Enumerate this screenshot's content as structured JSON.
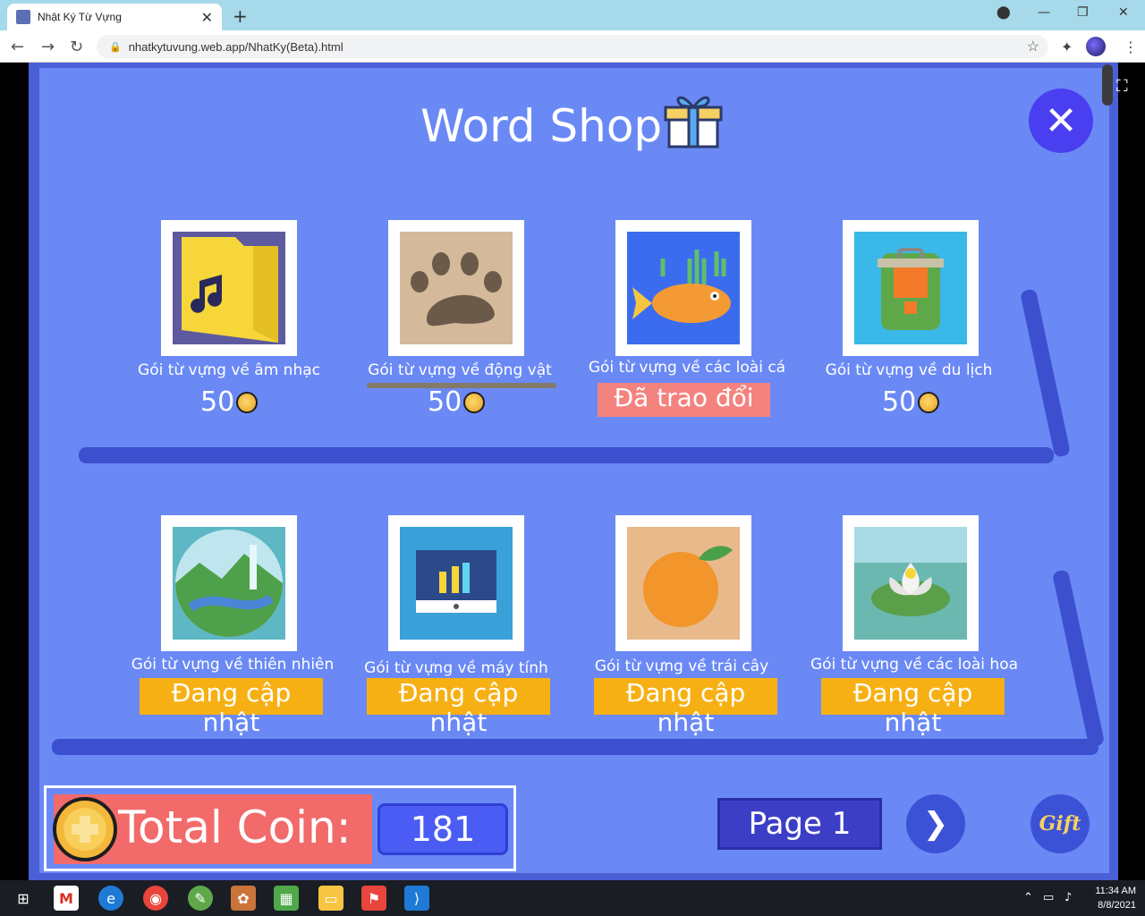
{
  "browser": {
    "tab_title": "Nhật Ký Từ Vựng",
    "url": "nhatkytuvung.web.app/NhatKy(Beta).html"
  },
  "shop": {
    "title": "Word Shop",
    "items_row1": [
      {
        "name": "Gói từ vựng về âm nhạc",
        "price": "50",
        "status": "price",
        "icon": "music-folder-icon"
      },
      {
        "name": "Gói từ vựng về động vật",
        "price": "50",
        "status": "price",
        "icon": "paw-print-icon"
      },
      {
        "name": "Gói từ vựng về các loài cá",
        "badge": "Đã trao đổi",
        "status": "exchanged",
        "icon": "fish-icon"
      },
      {
        "name": "Gói từ vựng về du lịch",
        "price": "50",
        "status": "price",
        "icon": "backpack-icon"
      }
    ],
    "items_row2": [
      {
        "name": "Gói từ vựng về thiên nhiên",
        "badge": "Đang cập nhật",
        "status": "updating",
        "icon": "landscape-icon"
      },
      {
        "name": "Gói từ vựng về máy tính",
        "badge": "Đang cập nhật",
        "status": "updating",
        "icon": "monitor-icon"
      },
      {
        "name": "Gói từ vựng về trái cây",
        "badge": "Đang cập nhật",
        "status": "updating",
        "icon": "orange-fruit-icon"
      },
      {
        "name": "Gói từ vựng về các loài hoa",
        "badge": "Đang cập nhật",
        "status": "updating",
        "icon": "lotus-flower-icon"
      }
    ],
    "total_coin_label": "Total Coin:",
    "total_coin_value": "181",
    "page_label": "Page 1",
    "gift_label": "Gift"
  },
  "taskbar": {
    "time": "11:34 AM",
    "date": "8/8/2021"
  },
  "colors": {
    "game_bg": "#6a89f5",
    "track": "#3c4fcf",
    "exchanged_badge": "#f4827f",
    "updating_badge": "#f7b014",
    "total_coin_bg": "#f26a6a"
  }
}
